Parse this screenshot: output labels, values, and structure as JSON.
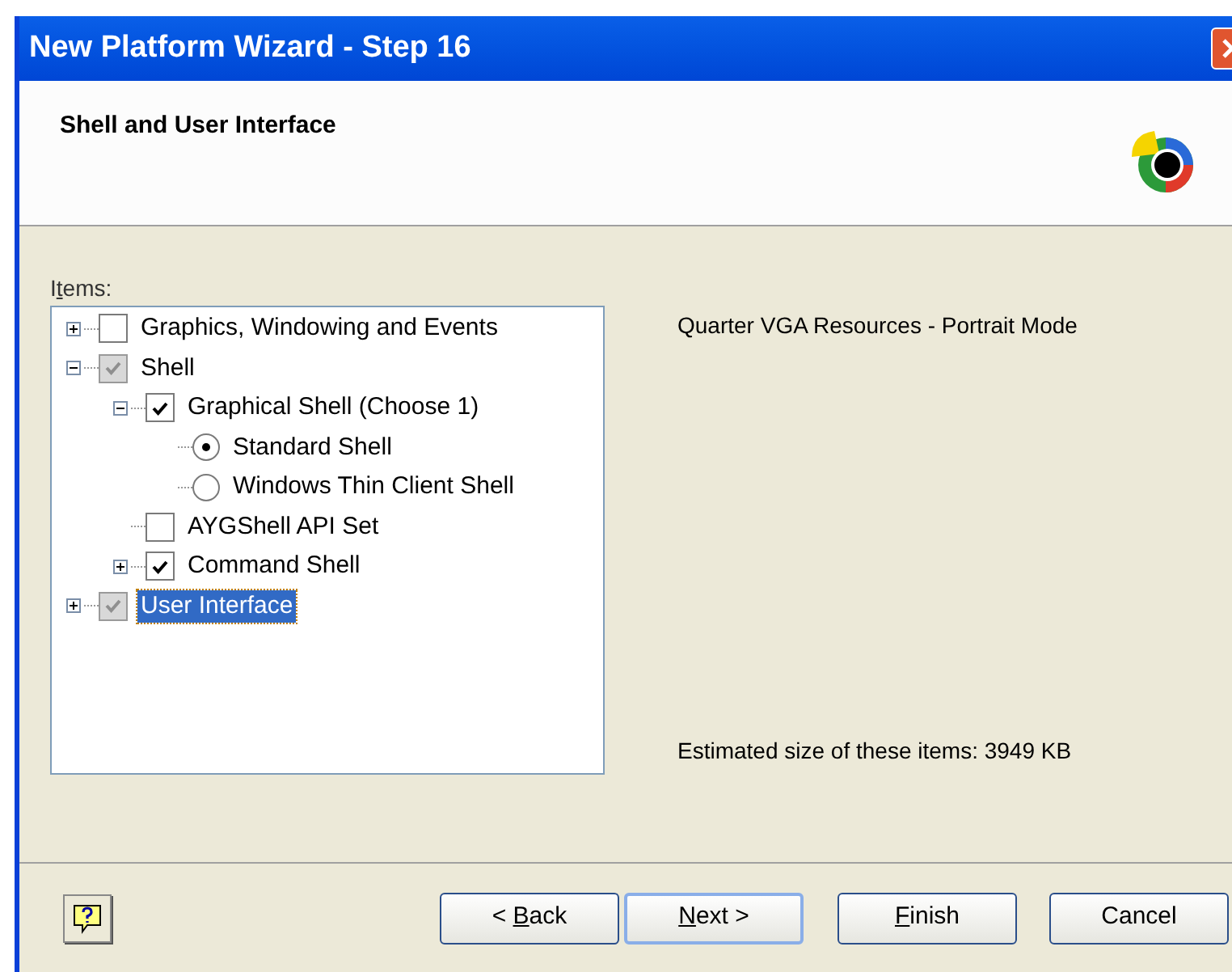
{
  "window": {
    "title": "New Platform Wizard - Step 16"
  },
  "header": {
    "title": "Shell and User Interface"
  },
  "items_label": {
    "pre": "I",
    "key": "t",
    "post": "ems:"
  },
  "tree": [
    {
      "label": "Graphics, Windowing and Events",
      "kind": "checkbox",
      "checked": false,
      "disabled": false,
      "expanded": false,
      "selected": false
    },
    {
      "label": "Shell",
      "kind": "checkbox",
      "checked": true,
      "disabled": true,
      "expanded": true,
      "selected": false,
      "children": [
        {
          "label": "Graphical Shell (Choose 1)",
          "kind": "checkbox",
          "checked": true,
          "disabled": false,
          "expanded": true,
          "selected": false,
          "children": [
            {
              "label": "Standard Shell",
              "kind": "radio",
              "checked": true,
              "selected": false
            },
            {
              "label": "Windows Thin Client Shell",
              "kind": "radio",
              "checked": false,
              "selected": false
            }
          ]
        },
        {
          "label": "AYGShell API Set",
          "kind": "checkbox",
          "checked": false,
          "disabled": false,
          "selected": false
        },
        {
          "label": "Command Shell",
          "kind": "checkbox",
          "checked": true,
          "disabled": false,
          "expanded": false,
          "selected": false
        }
      ]
    },
    {
      "label": "User Interface",
      "kind": "checkbox",
      "checked": true,
      "disabled": true,
      "expanded": false,
      "selected": true
    }
  ],
  "description": "Quarter VGA Resources - Portrait Mode",
  "estimate": "Estimated size of these items: 3949 KB",
  "buttons": [
    {
      "label": {
        "pre": "< ",
        "key": "B",
        "post": "ack"
      },
      "default": false
    },
    {
      "label": {
        "key": "N",
        "post": "ext >"
      },
      "default": true
    },
    {
      "label": {
        "key": "F",
        "post": "inish"
      },
      "default": false
    },
    {
      "label": {
        "pre": "Cancel"
      },
      "default": false
    }
  ]
}
